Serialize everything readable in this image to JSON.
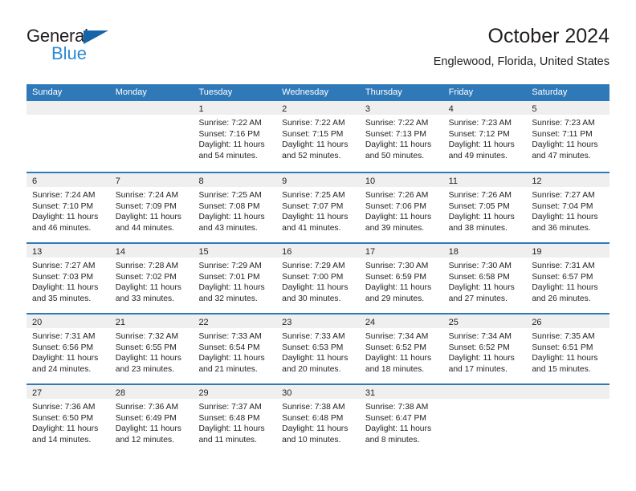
{
  "brand": {
    "name_part1": "General",
    "name_part2": "Blue",
    "triangle_color": "#1565a8",
    "blue_color": "#2b8ad4"
  },
  "header": {
    "title": "October 2024",
    "subtitle": "Englewood, Florida, United States"
  },
  "theme": {
    "header_blue": "#2f79b9",
    "day_band_gray": "#efefef",
    "text_color": "#231f20"
  },
  "weekdays": [
    "Sunday",
    "Monday",
    "Tuesday",
    "Wednesday",
    "Thursday",
    "Friday",
    "Saturday"
  ],
  "weeks": [
    [
      {
        "day": "",
        "sunrise": "",
        "sunset": "",
        "daylight_line1": "",
        "daylight_line2": "",
        "empty": true
      },
      {
        "day": "",
        "sunrise": "",
        "sunset": "",
        "daylight_line1": "",
        "daylight_line2": "",
        "empty": true
      },
      {
        "day": "1",
        "sunrise": "Sunrise: 7:22 AM",
        "sunset": "Sunset: 7:16 PM",
        "daylight_line1": "Daylight: 11 hours",
        "daylight_line2": "and 54 minutes."
      },
      {
        "day": "2",
        "sunrise": "Sunrise: 7:22 AM",
        "sunset": "Sunset: 7:15 PM",
        "daylight_line1": "Daylight: 11 hours",
        "daylight_line2": "and 52 minutes."
      },
      {
        "day": "3",
        "sunrise": "Sunrise: 7:22 AM",
        "sunset": "Sunset: 7:13 PM",
        "daylight_line1": "Daylight: 11 hours",
        "daylight_line2": "and 50 minutes."
      },
      {
        "day": "4",
        "sunrise": "Sunrise: 7:23 AM",
        "sunset": "Sunset: 7:12 PM",
        "daylight_line1": "Daylight: 11 hours",
        "daylight_line2": "and 49 minutes."
      },
      {
        "day": "5",
        "sunrise": "Sunrise: 7:23 AM",
        "sunset": "Sunset: 7:11 PM",
        "daylight_line1": "Daylight: 11 hours",
        "daylight_line2": "and 47 minutes."
      }
    ],
    [
      {
        "day": "6",
        "sunrise": "Sunrise: 7:24 AM",
        "sunset": "Sunset: 7:10 PM",
        "daylight_line1": "Daylight: 11 hours",
        "daylight_line2": "and 46 minutes."
      },
      {
        "day": "7",
        "sunrise": "Sunrise: 7:24 AM",
        "sunset": "Sunset: 7:09 PM",
        "daylight_line1": "Daylight: 11 hours",
        "daylight_line2": "and 44 minutes."
      },
      {
        "day": "8",
        "sunrise": "Sunrise: 7:25 AM",
        "sunset": "Sunset: 7:08 PM",
        "daylight_line1": "Daylight: 11 hours",
        "daylight_line2": "and 43 minutes."
      },
      {
        "day": "9",
        "sunrise": "Sunrise: 7:25 AM",
        "sunset": "Sunset: 7:07 PM",
        "daylight_line1": "Daylight: 11 hours",
        "daylight_line2": "and 41 minutes."
      },
      {
        "day": "10",
        "sunrise": "Sunrise: 7:26 AM",
        "sunset": "Sunset: 7:06 PM",
        "daylight_line1": "Daylight: 11 hours",
        "daylight_line2": "and 39 minutes."
      },
      {
        "day": "11",
        "sunrise": "Sunrise: 7:26 AM",
        "sunset": "Sunset: 7:05 PM",
        "daylight_line1": "Daylight: 11 hours",
        "daylight_line2": "and 38 minutes."
      },
      {
        "day": "12",
        "sunrise": "Sunrise: 7:27 AM",
        "sunset": "Sunset: 7:04 PM",
        "daylight_line1": "Daylight: 11 hours",
        "daylight_line2": "and 36 minutes."
      }
    ],
    [
      {
        "day": "13",
        "sunrise": "Sunrise: 7:27 AM",
        "sunset": "Sunset: 7:03 PM",
        "daylight_line1": "Daylight: 11 hours",
        "daylight_line2": "and 35 minutes."
      },
      {
        "day": "14",
        "sunrise": "Sunrise: 7:28 AM",
        "sunset": "Sunset: 7:02 PM",
        "daylight_line1": "Daylight: 11 hours",
        "daylight_line2": "and 33 minutes."
      },
      {
        "day": "15",
        "sunrise": "Sunrise: 7:29 AM",
        "sunset": "Sunset: 7:01 PM",
        "daylight_line1": "Daylight: 11 hours",
        "daylight_line2": "and 32 minutes."
      },
      {
        "day": "16",
        "sunrise": "Sunrise: 7:29 AM",
        "sunset": "Sunset: 7:00 PM",
        "daylight_line1": "Daylight: 11 hours",
        "daylight_line2": "and 30 minutes."
      },
      {
        "day": "17",
        "sunrise": "Sunrise: 7:30 AM",
        "sunset": "Sunset: 6:59 PM",
        "daylight_line1": "Daylight: 11 hours",
        "daylight_line2": "and 29 minutes."
      },
      {
        "day": "18",
        "sunrise": "Sunrise: 7:30 AM",
        "sunset": "Sunset: 6:58 PM",
        "daylight_line1": "Daylight: 11 hours",
        "daylight_line2": "and 27 minutes."
      },
      {
        "day": "19",
        "sunrise": "Sunrise: 7:31 AM",
        "sunset": "Sunset: 6:57 PM",
        "daylight_line1": "Daylight: 11 hours",
        "daylight_line2": "and 26 minutes."
      }
    ],
    [
      {
        "day": "20",
        "sunrise": "Sunrise: 7:31 AM",
        "sunset": "Sunset: 6:56 PM",
        "daylight_line1": "Daylight: 11 hours",
        "daylight_line2": "and 24 minutes."
      },
      {
        "day": "21",
        "sunrise": "Sunrise: 7:32 AM",
        "sunset": "Sunset: 6:55 PM",
        "daylight_line1": "Daylight: 11 hours",
        "daylight_line2": "and 23 minutes."
      },
      {
        "day": "22",
        "sunrise": "Sunrise: 7:33 AM",
        "sunset": "Sunset: 6:54 PM",
        "daylight_line1": "Daylight: 11 hours",
        "daylight_line2": "and 21 minutes."
      },
      {
        "day": "23",
        "sunrise": "Sunrise: 7:33 AM",
        "sunset": "Sunset: 6:53 PM",
        "daylight_line1": "Daylight: 11 hours",
        "daylight_line2": "and 20 minutes."
      },
      {
        "day": "24",
        "sunrise": "Sunrise: 7:34 AM",
        "sunset": "Sunset: 6:52 PM",
        "daylight_line1": "Daylight: 11 hours",
        "daylight_line2": "and 18 minutes."
      },
      {
        "day": "25",
        "sunrise": "Sunrise: 7:34 AM",
        "sunset": "Sunset: 6:52 PM",
        "daylight_line1": "Daylight: 11 hours",
        "daylight_line2": "and 17 minutes."
      },
      {
        "day": "26",
        "sunrise": "Sunrise: 7:35 AM",
        "sunset": "Sunset: 6:51 PM",
        "daylight_line1": "Daylight: 11 hours",
        "daylight_line2": "and 15 minutes."
      }
    ],
    [
      {
        "day": "27",
        "sunrise": "Sunrise: 7:36 AM",
        "sunset": "Sunset: 6:50 PM",
        "daylight_line1": "Daylight: 11 hours",
        "daylight_line2": "and 14 minutes."
      },
      {
        "day": "28",
        "sunrise": "Sunrise: 7:36 AM",
        "sunset": "Sunset: 6:49 PM",
        "daylight_line1": "Daylight: 11 hours",
        "daylight_line2": "and 12 minutes."
      },
      {
        "day": "29",
        "sunrise": "Sunrise: 7:37 AM",
        "sunset": "Sunset: 6:48 PM",
        "daylight_line1": "Daylight: 11 hours",
        "daylight_line2": "and 11 minutes."
      },
      {
        "day": "30",
        "sunrise": "Sunrise: 7:38 AM",
        "sunset": "Sunset: 6:48 PM",
        "daylight_line1": "Daylight: 11 hours",
        "daylight_line2": "and 10 minutes."
      },
      {
        "day": "31",
        "sunrise": "Sunrise: 7:38 AM",
        "sunset": "Sunset: 6:47 PM",
        "daylight_line1": "Daylight: 11 hours",
        "daylight_line2": "and 8 minutes."
      },
      {
        "day": "",
        "sunrise": "",
        "sunset": "",
        "daylight_line1": "",
        "daylight_line2": "",
        "empty": true
      },
      {
        "day": "",
        "sunrise": "",
        "sunset": "",
        "daylight_line1": "",
        "daylight_line2": "",
        "empty": true
      }
    ]
  ]
}
